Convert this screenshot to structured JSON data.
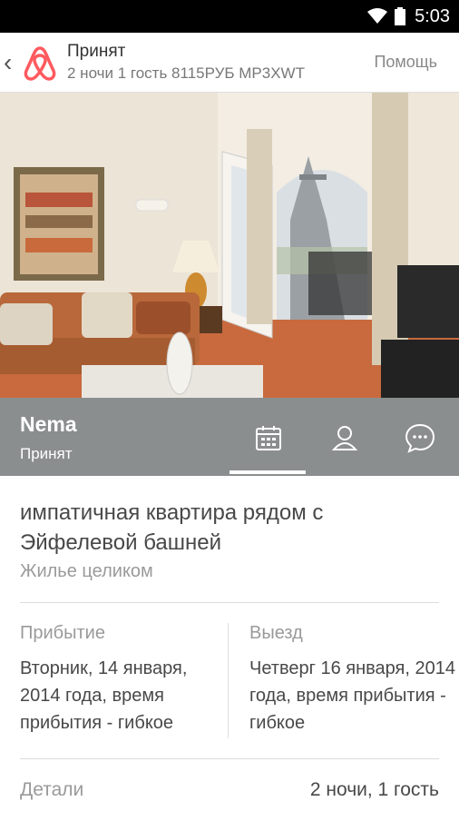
{
  "status_bar": {
    "time": "5:03",
    "wifi_icon": "wifi-icon",
    "battery_icon": "battery-icon"
  },
  "appbar": {
    "back_icon": "‹",
    "title": "Принят",
    "subtitle": "2 ночи   1 гость   8115РУБ   MP3XWT",
    "help": "Помощь"
  },
  "host": {
    "name": "Nema",
    "status": "Принят",
    "tabs": [
      "calendar-icon",
      "person-icon",
      "chat-icon"
    ]
  },
  "listing": {
    "title": "импатичная квартира рядом с Эйфелевой башней",
    "type": "Жилье целиком"
  },
  "checkin": {
    "label": "Прибытие",
    "value": "Вторник, 14 января, 2014 года, время прибытия - гибкое"
  },
  "checkout": {
    "label": "Выезд",
    "value": "Четверг 16 января, 2014 года, время прибытия - гибкое"
  },
  "details": {
    "label": "Детали",
    "value": "2 ночи, 1 гость"
  },
  "colors": {
    "host_bar": "#8a8e8f",
    "brand": "#ff5a5f"
  }
}
